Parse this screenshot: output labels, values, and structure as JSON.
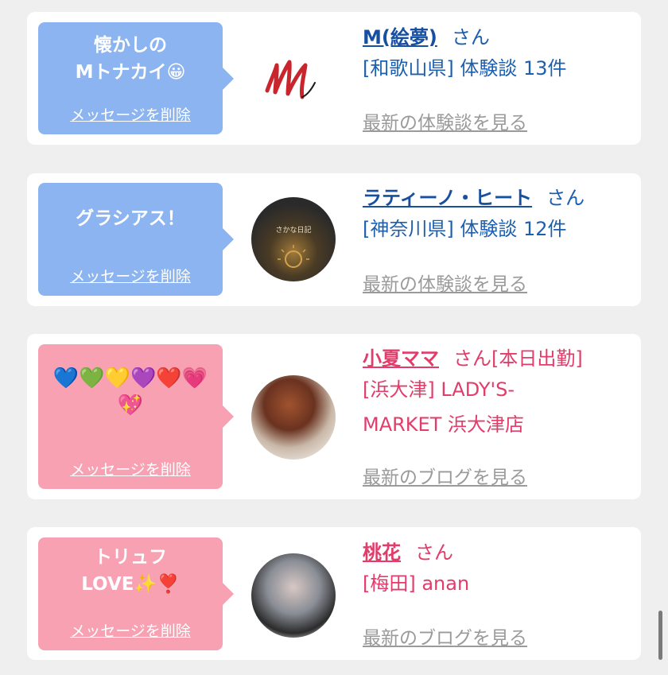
{
  "delete_label": "メッセージを削除",
  "san_label": "さん",
  "cards": [
    {
      "message": "懐かしの\nMトナカイ😀",
      "name": "M(絵夢)",
      "name_suffix": "",
      "location": "[和歌山県] 体験談 13件",
      "more_link": "最新の体験談を見る"
    },
    {
      "message": "グラシアス！",
      "name": "ラティーノ・ヒート",
      "name_suffix": "",
      "location": "[神奈川県] 体験談 12件",
      "more_link": "最新の体験談を見る",
      "avatar_text": "さかな日記"
    },
    {
      "message": "💙💚💛💜❤️💗\n💖",
      "name": "小夏ママ",
      "name_suffix": "[本日出勤]",
      "location": "[浜大津] LADY'S-MARKET 浜大津店",
      "more_link": "最新のブログを見る"
    },
    {
      "message": "トリュフ\nLOVE✨❣️",
      "name": "桃花",
      "name_suffix": "",
      "location": "[梅田] anan",
      "more_link": "最新のブログを見る"
    }
  ],
  "colors": {
    "blue_bubble": "#8cb4f0",
    "pink_bubble": "#f7a1b3",
    "blue_text": "#1d5fae",
    "pink_text": "#e23c6a",
    "link_gray": "#9a9a9a"
  }
}
